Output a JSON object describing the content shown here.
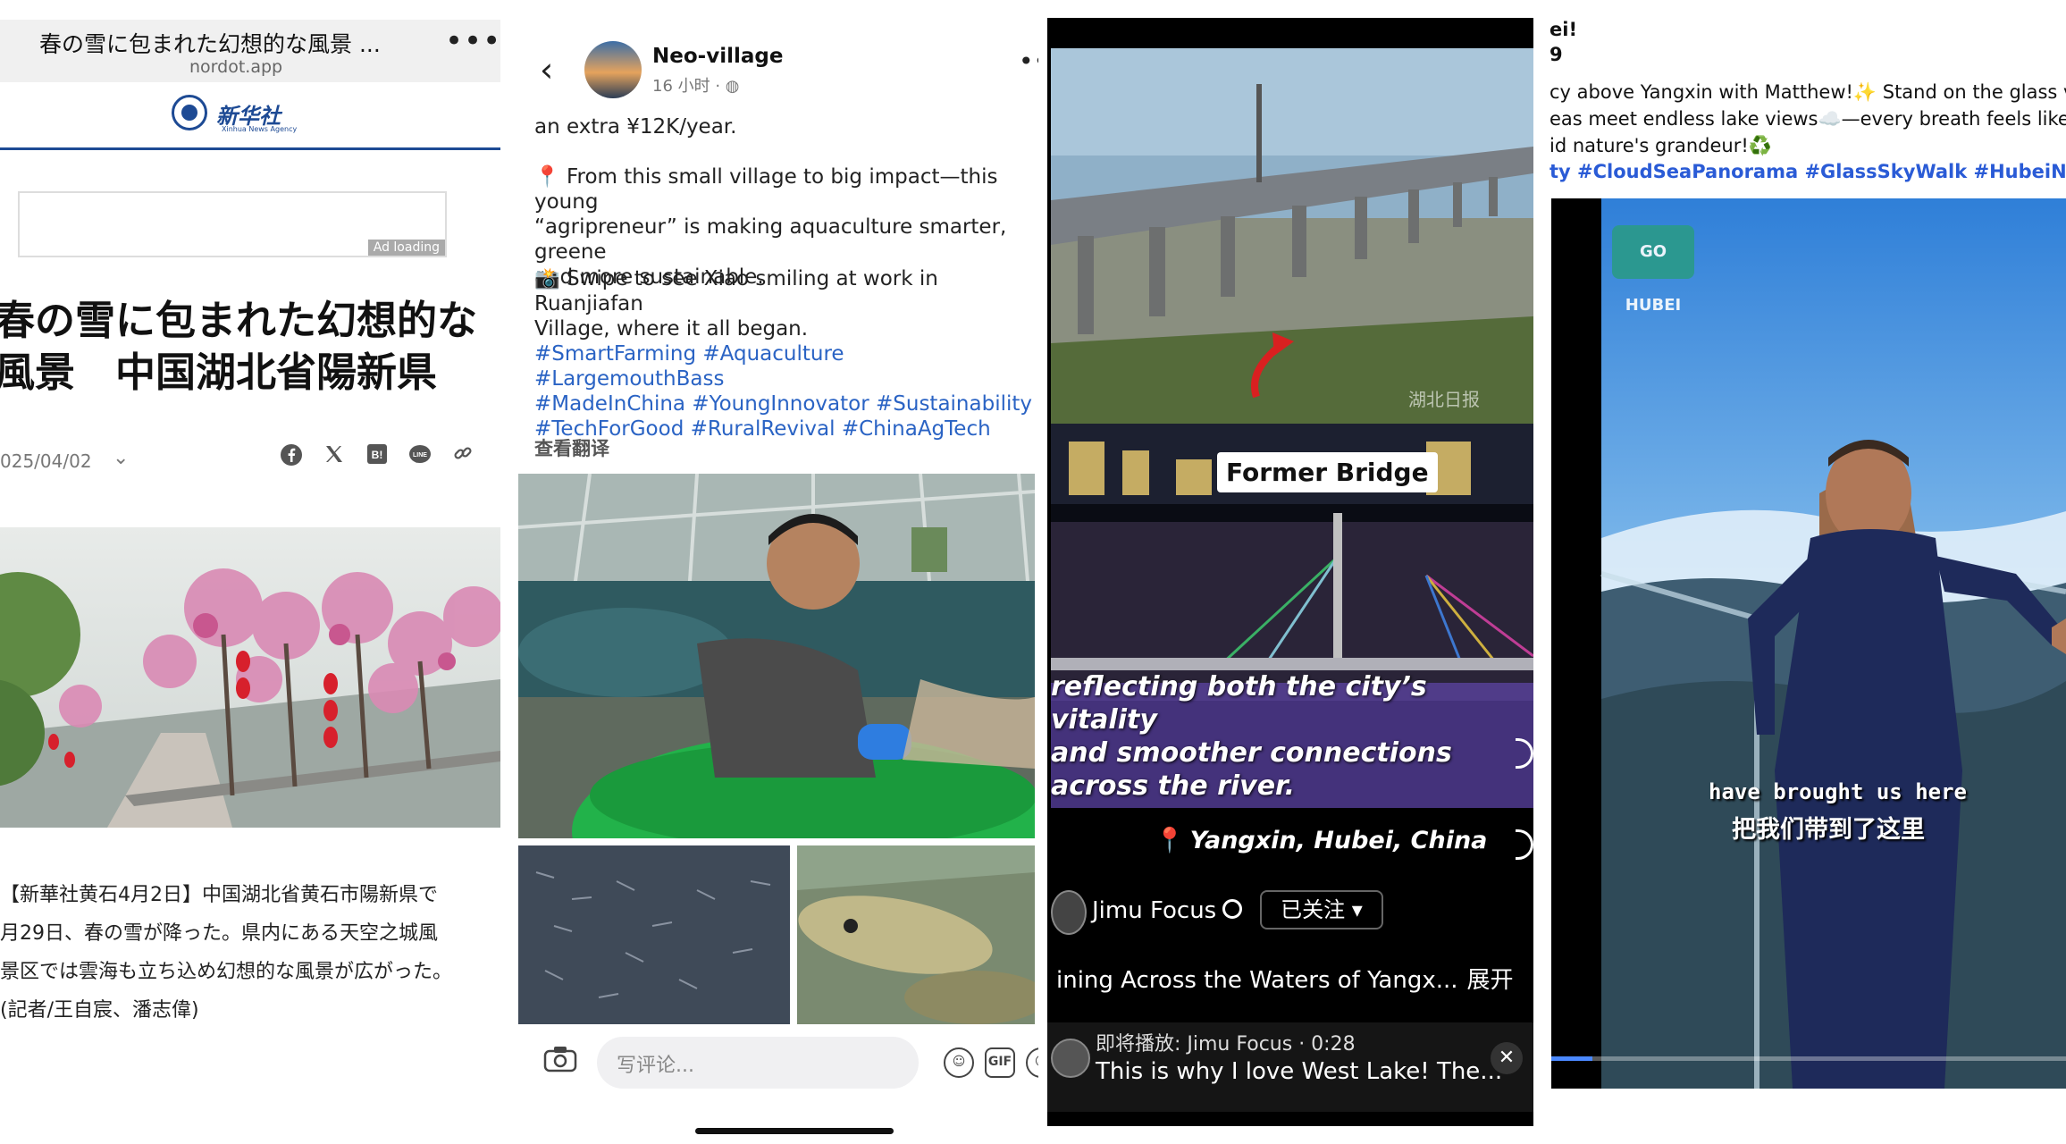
{
  "news": {
    "tab_title": "春の雪に包まれた幻想的な風景",
    "tab_ellipsis": "...",
    "domain": "nordot.app",
    "menu": "•••",
    "logo_text": "新华社",
    "logo_sub": "Xinhua News Agency",
    "ad_label": "Ad loading",
    "headline_line1": "春の雪に包まれた幻想的な",
    "headline_line2": "風景　中国湖北省陽新県",
    "date": "025/04/02",
    "share_icons": [
      "facebook-icon",
      "x-icon",
      "hatena-icon",
      "line-icon",
      "link-icon"
    ],
    "body_lines": [
      "【新華社黄石4月2日】中国湖北省黄石市陽新県で",
      "月29日、春の雪が降った。県内にある天空之城風",
      "景区では雲海も立ち込め幻想的な風景が広がった。",
      "(記者/王自宸、潘志偉)"
    ]
  },
  "social": {
    "account": "Neo-village",
    "meta": "16 小时 · ",
    "more": "•••",
    "line_income": "an extra ¥12K/year.",
    "line_impact_1": "📍 From this small village to big impact—this young",
    "line_impact_2": "“agripreneur” is making aquaculture smarter, greene",
    "line_impact_3": "and more sustainable.",
    "line_swipe_1": "📸 Swipe to see Xiao smiling at work in Ruanjiafan",
    "line_swipe_2": "Village, where it all began.",
    "hashtags_1": "#SmartFarming #Aquaculture #LargemouthBass",
    "hashtags_2": "#MadeInChina #YoungInnovator #Sustainability",
    "hashtags_3": "#TechForGood #RuralRevival #ChinaAgTech",
    "translate": "查看翻译",
    "comment_placeholder": "写评论...",
    "gif": "GIF"
  },
  "video": {
    "label": "Former Bridge",
    "caption_1": "reflecting both the city’s vitality",
    "caption_2": "and smoother connections",
    "caption_3": "across the river.",
    "location": "Yangxin, Hubei, China",
    "account": "Jimu Focus",
    "follow": "已关注 ▾",
    "title": "ining Across the Waters of Yangx...",
    "expand": "展开",
    "next_label": "即将播放:  Jimu Focus · 0:28",
    "next_title": "This is why I love West Lake! The...",
    "close": "✕",
    "watermark": "湖北日报"
  },
  "travel": {
    "line_1": "ei!",
    "line_2": "9",
    "line_3": "cy above Yangxin with Matthew!✨ Stand on the glass viewin",
    "line_4": "eas meet endless lake views☁️—every breath feels like touch",
    "line_5": "id nature's grandeur!♻️",
    "hashtags": "ty #CloudSeaPanorama #GlassSkyWalk #HubeiNatureGem",
    "badge": "GO HUBEI",
    "subtitle_en": "have brought us here",
    "subtitle_zh": "把我们带到了这里",
    "progress_fraction": 0.08
  }
}
